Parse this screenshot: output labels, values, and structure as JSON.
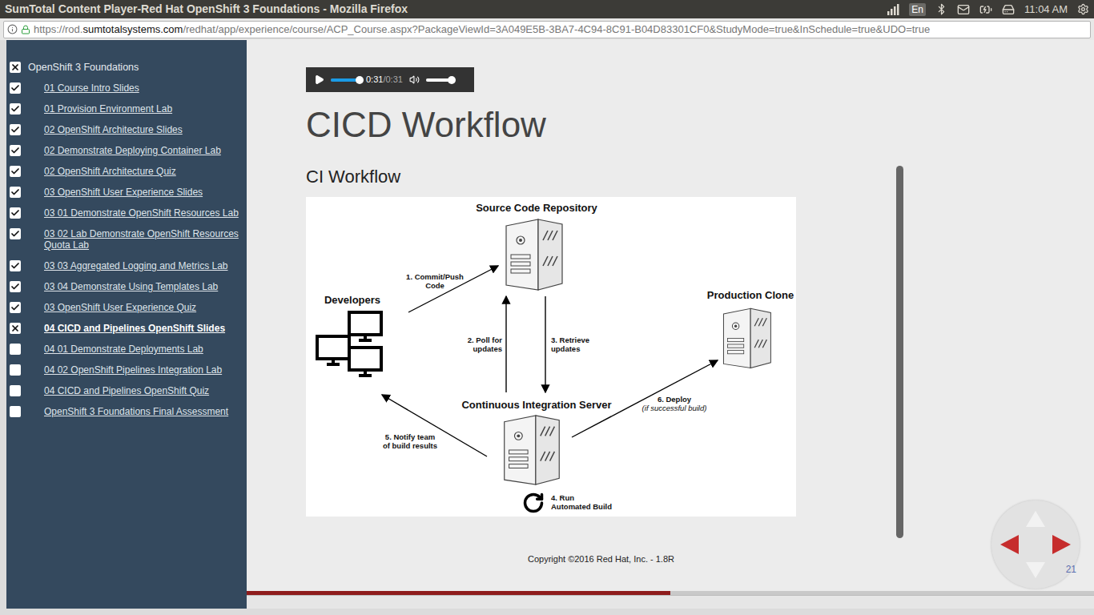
{
  "window": {
    "title": "SumTotal Content Player-Red Hat OpenShift 3 Foundations - Mozilla Firefox"
  },
  "tray": {
    "keyboard": "En",
    "time": "11:04 AM"
  },
  "address_bar": {
    "prefix": "https://rod.",
    "host": "sumtotalsystems.com",
    "path": "/redhat/app/experience/course/ACP_Course.aspx?PackageViewId=3A049E5B-3BA7-4C94-8C91-B04D83301CF0&StudyMode=true&InSchedule=true&UDO=true",
    "secure": true
  },
  "sidebar": {
    "title": "OpenShift 3 Foundations",
    "title_status": "in-progress",
    "items": [
      {
        "label": "01 Course Intro Slides",
        "status": "complete",
        "selected": false
      },
      {
        "label": "01 Provision Environment Lab",
        "status": "complete",
        "selected": false
      },
      {
        "label": "02 OpenShift Architecture Slides",
        "status": "complete",
        "selected": false
      },
      {
        "label": "02 Demonstrate Deploying Container Lab",
        "status": "complete",
        "selected": false
      },
      {
        "label": "02 OpenShift Architecture Quiz",
        "status": "complete",
        "selected": false
      },
      {
        "label": "03 OpenShift User Experience Slides",
        "status": "complete",
        "selected": false
      },
      {
        "label": "03 01 Demonstrate OpenShift Resources Lab",
        "status": "complete",
        "selected": false
      },
      {
        "label": "03 02 Lab Demonstrate OpenShift Resources Quota Lab",
        "status": "complete",
        "selected": false
      },
      {
        "label": "03 03 Aggregated Logging and Metrics Lab",
        "status": "complete",
        "selected": false
      },
      {
        "label": "03 04 Demonstrate Using Templates Lab",
        "status": "complete",
        "selected": false
      },
      {
        "label": "03 OpenShift User Experience Quiz",
        "status": "complete",
        "selected": false
      },
      {
        "label": "04 CICD and Pipelines OpenShift Slides",
        "status": "in-progress",
        "selected": true
      },
      {
        "label": "04 01 Demonstrate Deployments Lab",
        "status": "not-started",
        "selected": false
      },
      {
        "label": "04 02 OpenShift Pipelines Integration Lab",
        "status": "not-started",
        "selected": false
      },
      {
        "label": "04 CICD and Pipelines OpenShift Quiz",
        "status": "not-started",
        "selected": false
      },
      {
        "label": "OpenShift 3 Foundations Final Assessment",
        "status": "not-started",
        "selected": false
      }
    ]
  },
  "player": {
    "playing": false,
    "elapsed": "0:31",
    "separator": "/",
    "duration": "0:31",
    "level": 1,
    "volume": 0.9,
    "muted": false
  },
  "slide": {
    "title": "CICD Workflow",
    "subtitle": "CI Workflow",
    "copyright": "Copyright ©2016 Red Hat, Inc. - 1.8R",
    "page": "21"
  },
  "diagram": {
    "nodes": [
      {
        "label": "Source Code Repository",
        "kind": "server"
      },
      {
        "label": "Developers",
        "kind": "monitors"
      },
      {
        "label": "Production Clone",
        "kind": "server"
      },
      {
        "label": "Continuous Integration Server",
        "kind": "server"
      }
    ],
    "steps": [
      {
        "lines": [
          "1. Commit/Push",
          "Code"
        ],
        "kind": "arrow"
      },
      {
        "lines": [
          "2. Poll for",
          "updates"
        ],
        "kind": "arrow"
      },
      {
        "lines": [
          "3. Retrieve",
          "updates"
        ],
        "kind": "arrow"
      },
      {
        "lines": [
          "4. Run",
          "Automated Build"
        ],
        "kind": "loop"
      },
      {
        "lines": [
          "5. Notify team",
          "of build results"
        ],
        "kind": "arrow"
      },
      {
        "lines": [
          "6. Deploy"
        ],
        "note": "(if successful build)",
        "kind": "arrow"
      }
    ]
  },
  "navigation": {
    "prev_enabled": true,
    "next_enabled": true,
    "up_enabled": false,
    "down_enabled": false
  },
  "course_progress": {
    "level": 0.5
  }
}
